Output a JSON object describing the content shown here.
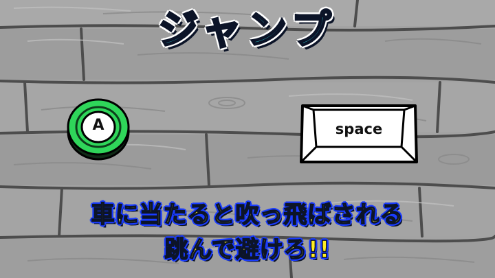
{
  "title": "ジャンプ",
  "controls": {
    "gamepad_button_label": "A",
    "keyboard_key_label": "space"
  },
  "instruction": {
    "line1": "車に当たると吹っ飛ばされる",
    "line2": "跳んで避けろ!!"
  },
  "colors": {
    "title_fill": "#33dde4",
    "instruction_fill": "#ffee22",
    "instruction_outline": "#1a3cff",
    "button_green": "#2fd65a",
    "wood_gray": "#9a9a9a"
  }
}
